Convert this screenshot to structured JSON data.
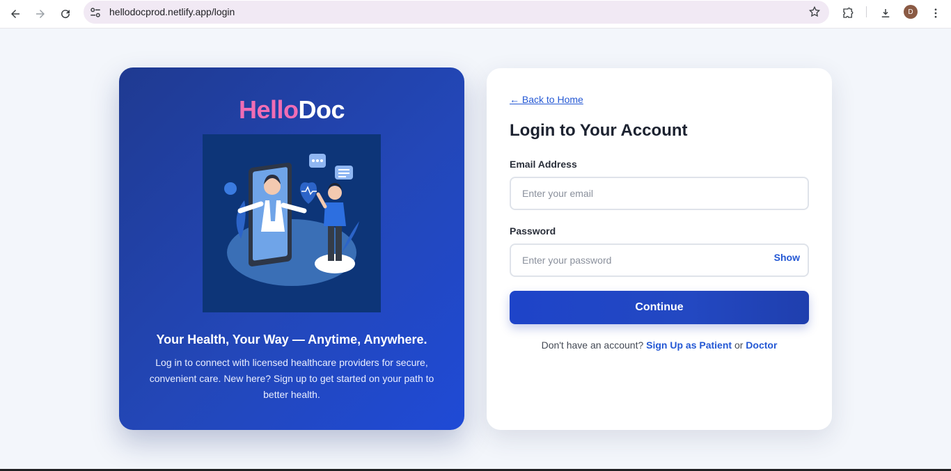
{
  "browser": {
    "url": "hellodocprod.netlify.app/login",
    "avatar_letter": "D"
  },
  "hero": {
    "brand_part1": "Hello",
    "brand_part2": "Doc",
    "title": "Your Health, Your Way — Anytime, Anywhere.",
    "description": "Log in to connect with licensed healthcare providers for secure, convenient care. New here? Sign up to get started on your path to better health."
  },
  "login": {
    "back_link": "← Back to Home",
    "title": "Login to Your Account",
    "email_label": "Email Address",
    "email_placeholder": "Enter your email",
    "password_label": "Password",
    "password_placeholder": "Enter your password",
    "show_label": "Show",
    "continue_label": "Continue",
    "signup_prefix": "Don't have an account?",
    "signup_patient": "Sign Up as Patient",
    "signup_or": "or",
    "signup_doctor": "Doctor"
  },
  "colors": {
    "accent": "#2458d4",
    "brand_pink": "#f06db4",
    "hero_bg": "#2347b8"
  }
}
